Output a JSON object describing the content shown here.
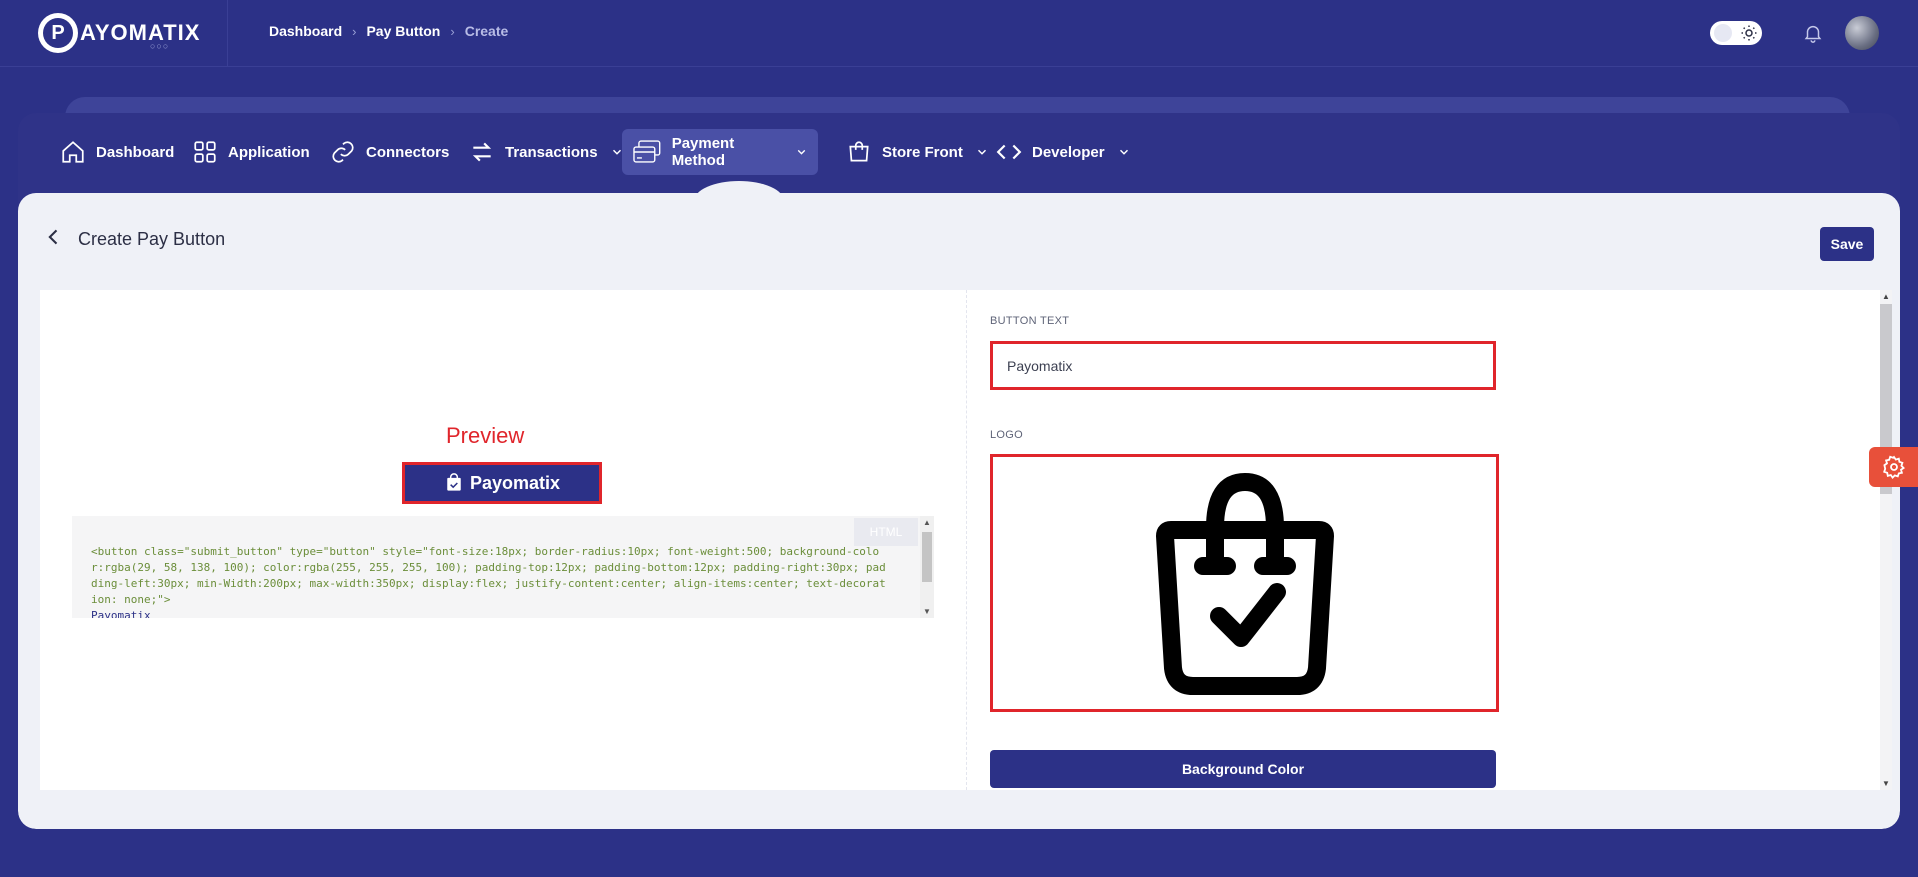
{
  "topbar": {
    "brand": "AYOMATIX",
    "brand_initial": "P",
    "brand_dots": "○○○",
    "breadcrumb": [
      "Dashboard",
      "Pay Button",
      "Create"
    ]
  },
  "nav": {
    "items": [
      {
        "label": "Dashboard",
        "icon": "home-icon"
      },
      {
        "label": "Application",
        "icon": "grid-icon"
      },
      {
        "label": "Connectors",
        "icon": "link-icon"
      },
      {
        "label": "Transactions",
        "icon": "arrows-icon",
        "dropdown": true
      },
      {
        "label": "Payment Method",
        "icon": "cards-icon",
        "dropdown": true,
        "active": true
      },
      {
        "label": "Store Front",
        "icon": "bag-icon",
        "dropdown": true
      },
      {
        "label": "Developer",
        "icon": "code-icon",
        "dropdown": true
      }
    ]
  },
  "page": {
    "title": "Create Pay Button",
    "save_label": "Save"
  },
  "preview": {
    "label": "Preview",
    "button_text": "Payomatix",
    "code_tag": "HTML",
    "code_lines": [
      "<button class=\"submit_button\" type=\"button\" style=\"font-size:18px; border-radius:10px; font-weight:500; background-color:rgba(29, 58, 138, 100); color:rgba(255, 255, 255, 100); padding-top:12px; padding-bottom:12px; padding-right:30px; padding-left:30px; min-Width:200px; max-width:350px; display:flex; justify-content:center; align-items:center; text-decoration: none;\">",
      "Payomatix"
    ]
  },
  "form": {
    "button_text_label": "BUTTON TEXT",
    "button_text_value": "Payomatix",
    "logo_label": "LOGO",
    "background_color_label": "Background Color"
  },
  "colors": {
    "brand": "#2c3187",
    "accent_red": "#e0252b",
    "content_bg": "#eff1f7",
    "fab": "#e8503a"
  }
}
